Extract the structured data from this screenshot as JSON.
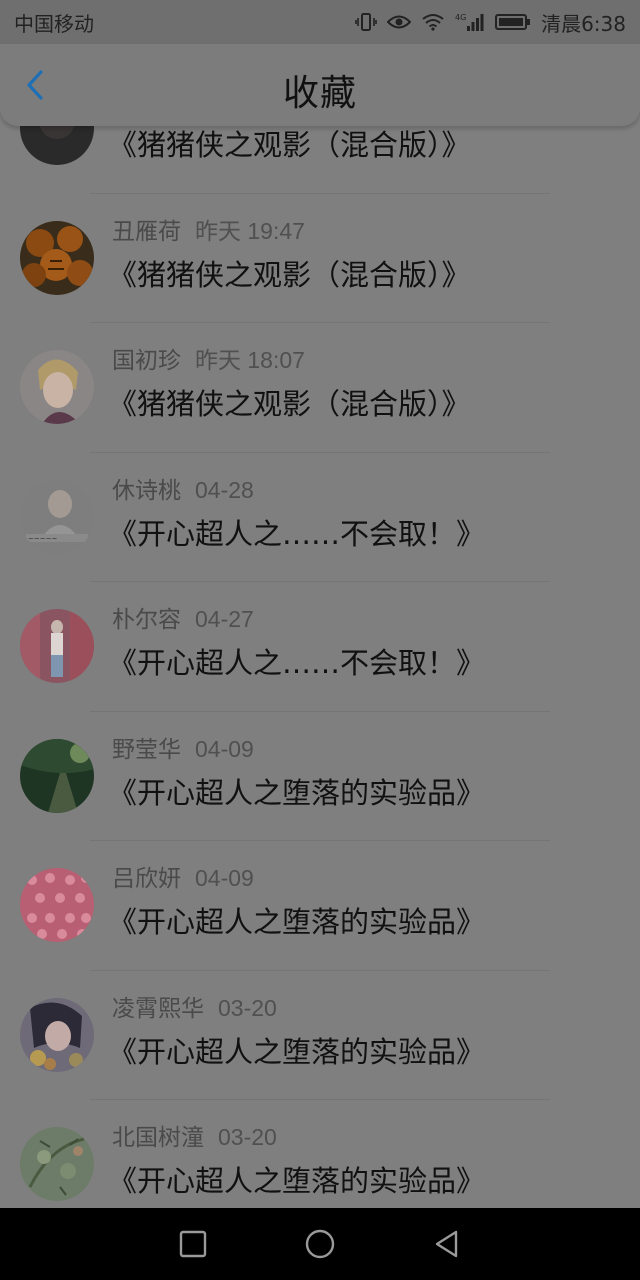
{
  "status_bar": {
    "carrier": "中国移动",
    "network": "4G",
    "time": "清晨6:38"
  },
  "header": {
    "title": "收藏",
    "back_icon": "chevron-left-icon"
  },
  "colors": {
    "accent": "#1e88e5",
    "overlay": "#7f7f7f"
  },
  "favorites": [
    {
      "name": "",
      "date": "",
      "message": "《猪猪侠之观影（混合版）》",
      "avatar": "avatar-dark"
    },
    {
      "name": "丑雁荷",
      "date": "昨天 19:47",
      "message": "《猪猪侠之观影（混合版）》",
      "avatar": "avatar-pumpkins"
    },
    {
      "name": "国初珍",
      "date": "昨天 18:07",
      "message": "《猪猪侠之观影（混合版）》",
      "avatar": "avatar-anime-boy"
    },
    {
      "name": "休诗桃",
      "date": "04-28",
      "message": "《开心超人之……不会取！》",
      "avatar": "avatar-girl-text"
    },
    {
      "name": "朴尔容",
      "date": "04-27",
      "message": "《开心超人之……不会取！》",
      "avatar": "avatar-street"
    },
    {
      "name": "野莹华",
      "date": "04-09",
      "message": "《开心超人之堕落的实验品》",
      "avatar": "avatar-green-path"
    },
    {
      "name": "吕欣妍",
      "date": "04-09",
      "message": "《开心超人之堕落的实验品》",
      "avatar": "avatar-pink-pattern"
    },
    {
      "name": "凌霄熙华",
      "date": "03-20",
      "message": "《开心超人之堕落的实验品》",
      "avatar": "avatar-girl-flowers"
    },
    {
      "name": "北国树潼",
      "date": "03-20",
      "message": "《开心超人之堕落的实验品》",
      "avatar": "avatar-green-floral"
    }
  ],
  "nav_bar": {
    "recent_icon": "square-icon",
    "home_icon": "circle-icon",
    "back_icon": "triangle-back-icon"
  }
}
